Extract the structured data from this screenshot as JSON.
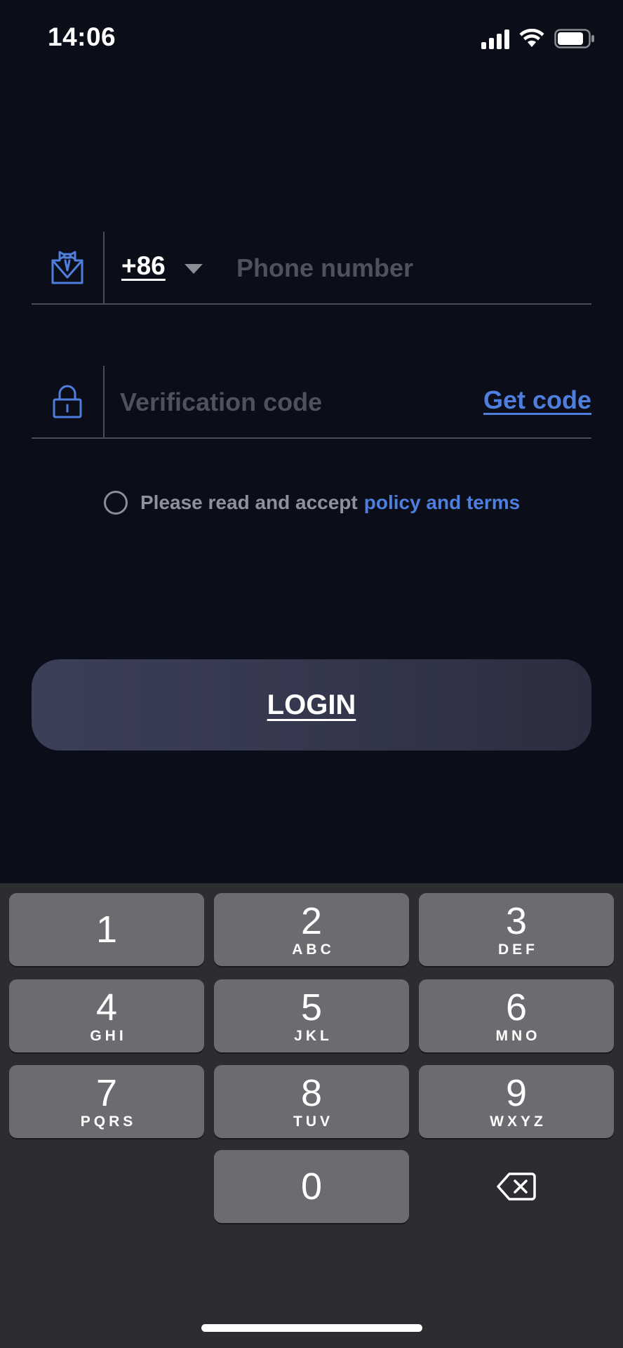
{
  "status_bar": {
    "time": "14:06",
    "icons": [
      "signal-icon",
      "wifi-icon",
      "battery-icon"
    ]
  },
  "phone_field": {
    "icon": "user-tie-icon",
    "country_code": "+86",
    "placeholder": "Phone number",
    "value": ""
  },
  "code_field": {
    "icon": "lock-icon",
    "placeholder": "Verification code",
    "value": "",
    "get_code_label": "Get code"
  },
  "agreement": {
    "checked": false,
    "text": "Please read and accept",
    "link_label": "policy and terms"
  },
  "login_button": {
    "label": "LOGIN"
  },
  "keyboard": {
    "keys": [
      {
        "digit": "1",
        "letters": ""
      },
      {
        "digit": "2",
        "letters": "ABC"
      },
      {
        "digit": "3",
        "letters": "DEF"
      },
      {
        "digit": "4",
        "letters": "GHI"
      },
      {
        "digit": "5",
        "letters": "JKL"
      },
      {
        "digit": "6",
        "letters": "MNO"
      },
      {
        "digit": "7",
        "letters": "PQRS"
      },
      {
        "digit": "8",
        "letters": "TUV"
      },
      {
        "digit": "9",
        "letters": "WXYZ"
      },
      {
        "digit": "0",
        "letters": ""
      }
    ],
    "delete_icon": "backspace-icon"
  },
  "colors": {
    "background": "#0b0e19",
    "accent": "#4f7fde",
    "muted_text": "#8e919a",
    "placeholder": "#4e525d",
    "keyboard_bg": "#2c2d31",
    "key_bg": "#6b6c6f"
  }
}
